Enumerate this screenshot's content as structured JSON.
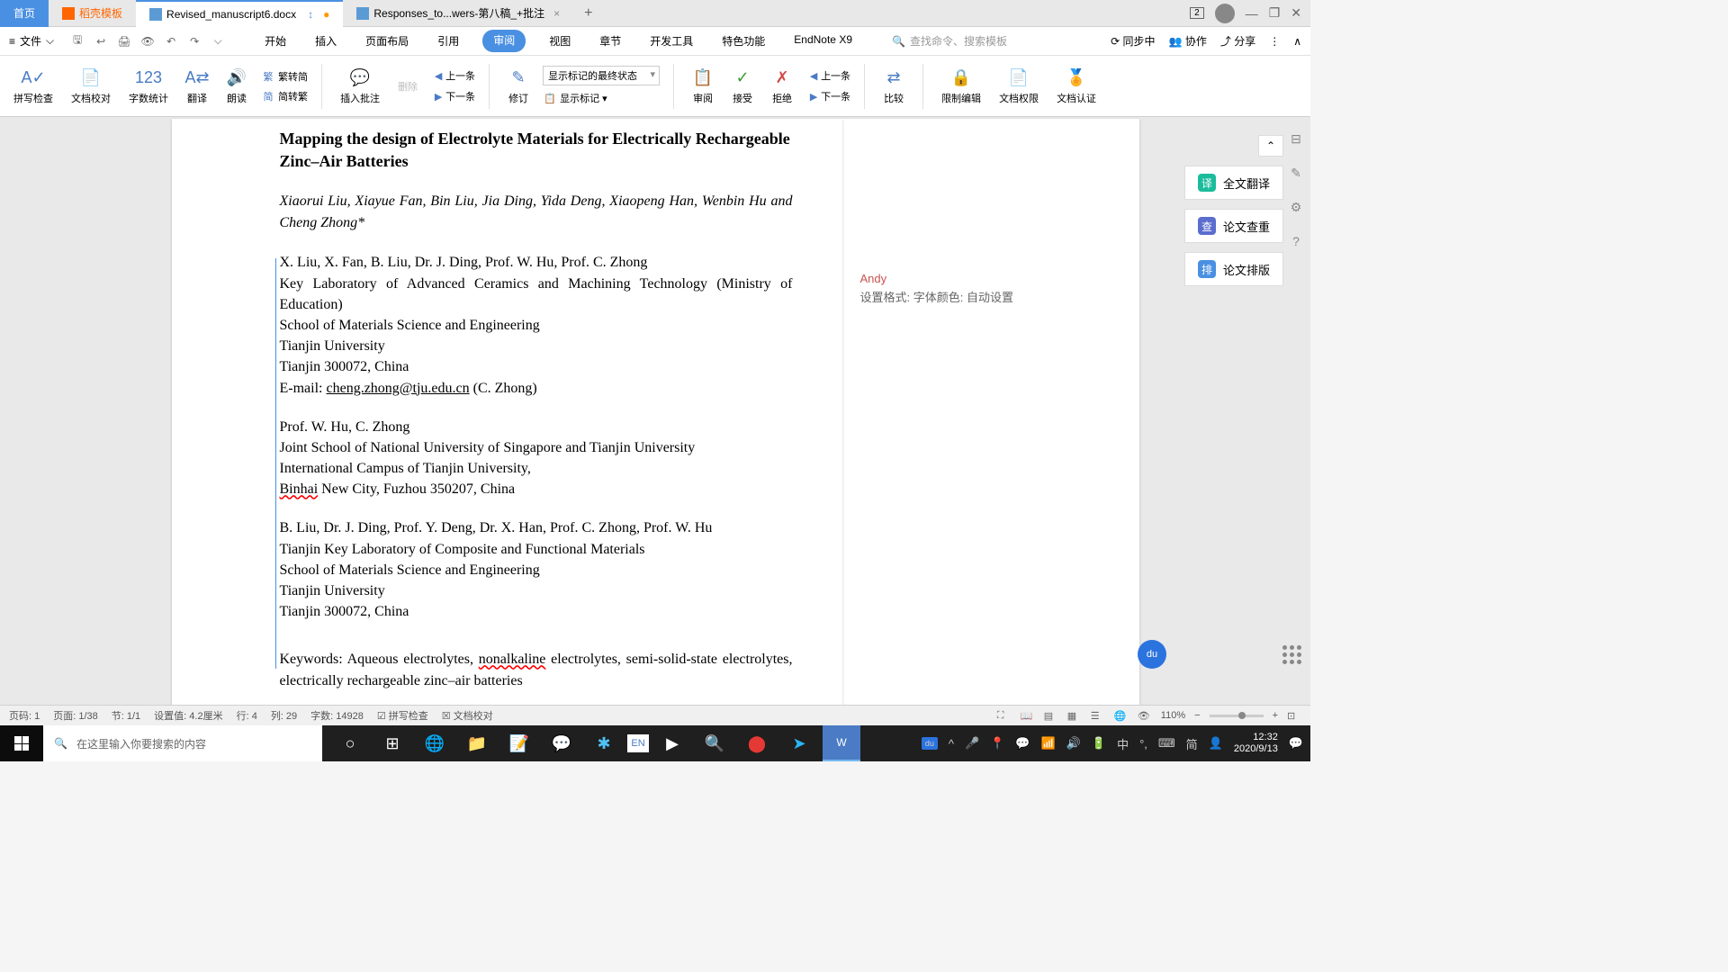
{
  "tabs": {
    "home": "首页",
    "doke": "稻壳模板",
    "doc1": "Revised_manuscript6.docx",
    "doc2": "Responses_to...wers-第八稿_+批注",
    "badge": "2"
  },
  "menu": {
    "file": "文件",
    "tabs": [
      "开始",
      "插入",
      "页面布局",
      "引用",
      "审阅",
      "视图",
      "章节",
      "开发工具",
      "特色功能",
      "EndNote X9"
    ],
    "active_tab": "审阅",
    "search_placeholder": "查找命令、搜索模板",
    "sync": "同步中",
    "collab": "协作",
    "share": "分享"
  },
  "ribbon": {
    "spellcheck": "拼写检查",
    "doccheck": "文档校对",
    "wordcount": "字数统计",
    "translate": "翻译",
    "read": "朗读",
    "simp2trad": "繁转简",
    "trad2simp": "简转繁",
    "insert_comment": "插入批注",
    "delete": "删除",
    "prev": "上一条",
    "next": "下一条",
    "modify": "修订",
    "markup_dropdown": "显示标记的最终状态",
    "show_markup": "显示标记",
    "review": "审阅",
    "accept": "接受",
    "reject": "拒绝",
    "prev2": "上一条",
    "next2": "下一条",
    "compare": "比较",
    "restrict": "限制编辑",
    "permission": "文档权限",
    "certify": "文档认证"
  },
  "document": {
    "title": "Mapping the design of Electrolyte Materials for Electrically Rechargeable Zinc–Air Batteries",
    "authors": "Xiaorui Liu, Xiayue Fan, Bin Liu, Jia Ding, Yida Deng, Xiaopeng Han, Wenbin Hu and Cheng Zhong*",
    "aff1_line1": "X. Liu, X. Fan, B. Liu, Dr. J. Ding, Prof. W. Hu, Prof. C. Zhong",
    "aff1_line2": "Key Laboratory of Advanced Ceramics and Machining Technology (Ministry of Education)",
    "aff1_line3": "School of Materials Science and Engineering",
    "aff1_line4": "Tianjin University",
    "aff1_line5": "Tianjin 300072, China",
    "aff1_line6a": "E-mail: ",
    "aff1_email": "cheng.zhong@tju.edu.cn",
    "aff1_line6b": " (C. Zhong)",
    "aff2_line1": "Prof. W. Hu, C. Zhong",
    "aff2_line2": "Joint School of National University of Singapore and Tianjin University",
    "aff2_line3": "International Campus of Tianjin University,",
    "aff2_line4a": "Binhai",
    "aff2_line4b": " New City, Fuzhou 350207, China",
    "aff3_line1": "B. Liu, Dr. J. Ding, Prof. Y. Deng, Dr. X. Han, Prof. C. Zhong, Prof. W. Hu",
    "aff3_line2": "Tianjin Key Laboratory of Composite and Functional Materials",
    "aff3_line3": "School of Materials Science and Engineering",
    "aff3_line4": "Tianjin University",
    "aff3_line5": "Tianjin 300072, China",
    "keywords_a": "Keywords: Aqueous electrolytes, ",
    "keywords_non": "nonalkaline",
    "keywords_b": " electrolytes, semi-solid-state electrolytes, electrically rechargeable zinc–air batteries"
  },
  "comment": {
    "author": "Andy",
    "text": "设置格式: 字体颜色: 自动设置"
  },
  "sidebar": {
    "translate": "全文翻译",
    "plagiarism": "论文查重",
    "layout": "论文排版"
  },
  "status": {
    "page": "页码: 1",
    "pages": "页面: 1/38",
    "section": "节: 1/1",
    "setting": "设置值: 4.2厘米",
    "row": "行: 4",
    "col": "列: 29",
    "words": "字数: 14928",
    "spell": "拼写检查",
    "proof": "文档校对",
    "zoom": "110%"
  },
  "taskbar": {
    "search_placeholder": "在这里输入你要搜索的内容",
    "ime": "中",
    "ime2": "简",
    "lang": "EN",
    "time": "12:32",
    "date": "2020/9/13"
  }
}
